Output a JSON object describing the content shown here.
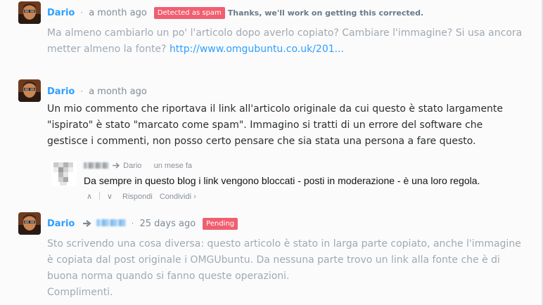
{
  "comments": [
    {
      "author": "Dario",
      "dot": "·",
      "time": "a month ago",
      "badge": "Detected as spam",
      "note": "Thanks, we'll work on getting this corrected.",
      "text": "Ma almeno cambiarlo un po' l'articolo dopo averlo copiato? Cambiare l'immagine? Si usa ancora metter almeno la fonte?",
      "link": "http://www.omgubuntu.co.uk/201..."
    },
    {
      "author": "Dario",
      "dot": "·",
      "time": "a month ago",
      "text": "Un mio commento che riportava il link all'articolo originale da cui questo è stato largamente \"ispirato\" è stato \"marcato come spam\". Immagino si tratti di un errore del software che gestisce i commenti, non posso certo pensare che sia stata una persona a fare questo."
    },
    {
      "author": "Dario",
      "dot": "·",
      "time": "25 days ago",
      "badge": "Pending",
      "text_lines": [
        "Sto scrivendo una cosa diversa: questo articolo è stato in larga parte copiato, anche l'immagine è copiata dal post originale i OMGUbuntu. Da nessuna parte trovo un link alla fonte che è di buona norma quando si fanno queste operazioni.",
        "Complimenti."
      ]
    }
  ],
  "reply": {
    "reply_to": "Dario",
    "time": "un mese fa",
    "text": "Da sempre in questo blog i link vengono bloccati - posti in moderazione - è una loro regola.",
    "upvote": "∧",
    "downvote": "∨",
    "reply_label": "Rispondi",
    "share_label": "Condividi ›"
  },
  "colors": {
    "author": "#2e9fff",
    "badge": "#f05f70",
    "muted_text": "#a0a9b0"
  }
}
